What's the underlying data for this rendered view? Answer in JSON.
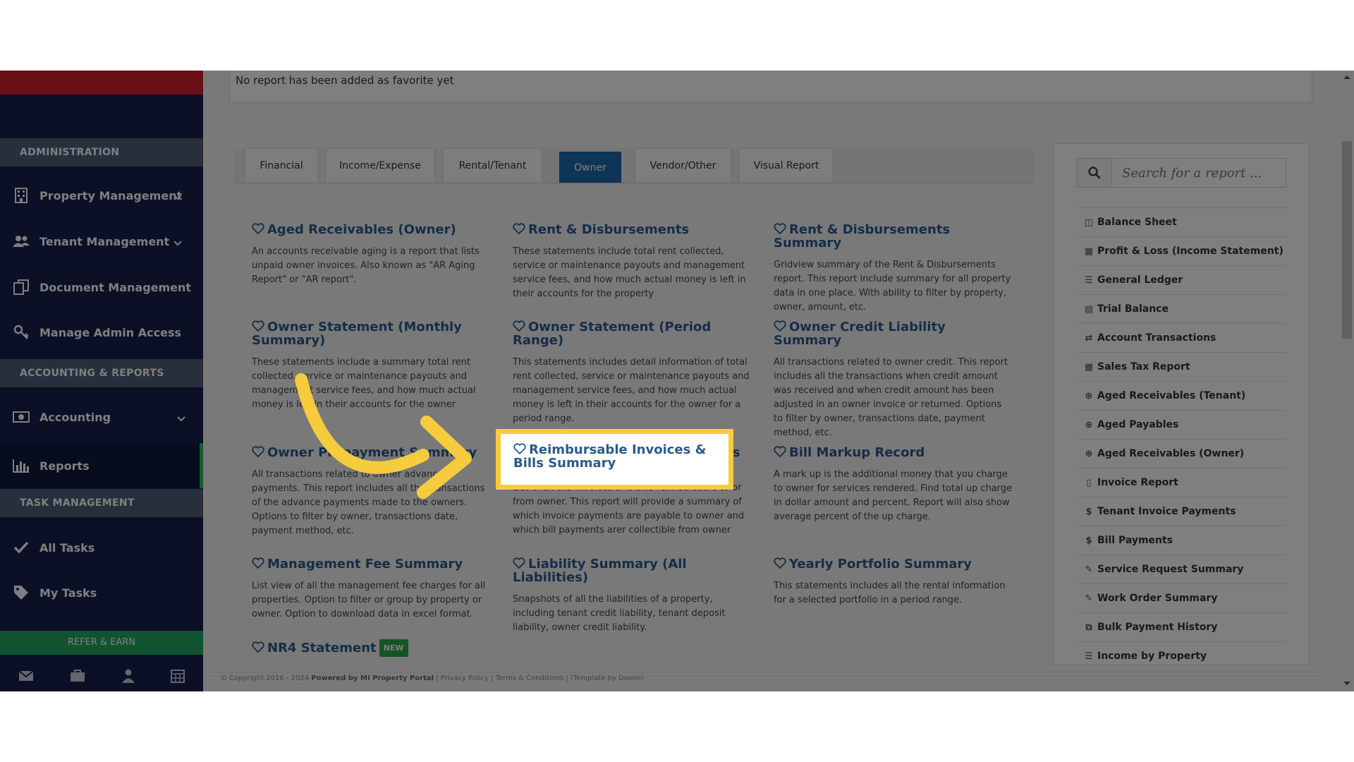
{
  "sidebar": {
    "sections": {
      "administration": "ADMINISTRATION",
      "accounting_reports": "ACCOUNTING & REPORTS",
      "task_management": "TASK MANAGEMENT"
    },
    "items": {
      "property_management": "Property Management",
      "tenant_management": "Tenant Management",
      "document_management": "Document Management",
      "manage_admin_access": "Manage Admin Access",
      "accounting": "Accounting",
      "reports": "Reports",
      "all_tasks": "All Tasks",
      "my_tasks": "My Tasks"
    },
    "refer_earn": "REFER & EARN"
  },
  "favorites": {
    "empty_text": "No report has been added as favorite yet"
  },
  "tabs": {
    "financial": "Financial",
    "income_expense": "Income/Expense",
    "rental_tenant": "Rental/Tenant",
    "owner": "Owner",
    "vendor_other": "Vendor/Other",
    "visual_report": "Visual Report",
    "active": "Owner"
  },
  "reports": {
    "aged_receivables_owner": {
      "title": "Aged Receivables (Owner)",
      "desc": "An accounts receivable aging is a report that lists unpaid owner invoices. Also known as \"AR Aging Report\" or \"AR report\"."
    },
    "rent_disbursements": {
      "title": "Rent & Disbursements",
      "desc": "These statements include total rent collected, service or maintenance payouts and management service fees, and how much actual money is left in their accounts for the property"
    },
    "rent_disbursements_summary": {
      "title": "Rent & Disbursements Summary",
      "desc": "Gridview summary of the Rent & Disbursements report. This report include summary for all property data in one place. With ability to filter by property, owner, amount, etc."
    },
    "owner_statement_monthly": {
      "title": "Owner Statement (Monthly Summary)",
      "desc": "These statements include a summary total rent collected, service or maintenance payouts and management service fees, and how much actual money is left in their accounts for the owner"
    },
    "owner_statement_period": {
      "title": "Owner Statement (Period Range)",
      "desc": "This statements includes detail information of total rent collected, service or maintenance payouts and management service fees, and how much actual money is left in their accounts for the owner for a period range."
    },
    "owner_credit_liability": {
      "title": "Owner Credit Liability Summary",
      "desc": "All transactions related to owner credit. This report includes all the transactions when credit amount was received and when credit amount has been adjusted in an owner invoice or returned. Options to filter by owner, transactions date, payment method, etc."
    },
    "owner_prepayment": {
      "title": "Owner Prepayment Summary",
      "desc": "All transactions related to owner advance payments. This report includes all the transactions of the advance payments made to the owners. Options to filter by owner, transactions date, payment method, etc."
    },
    "reimbursable": {
      "title": "Reimbursable Invoices & Bills Summary",
      "desc": "List of all the invoices and bills reimbursable to or from owner. This report will provide a summary of which invoice payments are payable to owner and which bill payments arer collectible from owner"
    },
    "bill_markup": {
      "title": "Bill Markup Record",
      "desc": "A mark up is the additional money that you charge to owner for services rendered. Find total up charge in dollar amount and percent. Report will also show average percent of the up charge."
    },
    "management_fee": {
      "title": "Management Fee Summary",
      "desc": "List view of all the management fee charges for all properties. Option to filter or group by property or owner. Option to download data in excel format."
    },
    "liability_summary": {
      "title": "Liability Summary (All Liabilities)",
      "desc": "Snapshots of all the liabilities of a property, including tenant credit liability, tenant deposit liability, owner credit liability."
    },
    "yearly_portfolio": {
      "title": "Yearly Portfolio Summary",
      "desc": "This statements includes all the rental information for a selected portfolio in a period range."
    },
    "nr4_statement": {
      "title": "NR4 Statement",
      "badge": "NEW"
    }
  },
  "search": {
    "placeholder": "Search for a report ..."
  },
  "quick_links": [
    {
      "label": "Balance Sheet",
      "icon": "columns-icon"
    },
    {
      "label": "Profit & Loss (Income Statement)",
      "icon": "calculator-icon"
    },
    {
      "label": "General Ledger",
      "icon": "list-icon"
    },
    {
      "label": "Trial Balance",
      "icon": "calendar-icon"
    },
    {
      "label": "Account Transactions",
      "icon": "exchange-icon"
    },
    {
      "label": "Sales Tax Report",
      "icon": "calculator-icon"
    },
    {
      "label": "Aged Receivables (Tenant)",
      "icon": "circle-plus-icon"
    },
    {
      "label": "Aged Payables",
      "icon": "circle-plus-icon"
    },
    {
      "label": "Aged Receivables (Owner)",
      "icon": "circle-plus-icon"
    },
    {
      "label": "Invoice Report",
      "icon": "file-icon"
    },
    {
      "label": "Tenant Invoice Payments",
      "icon": "dollar-icon"
    },
    {
      "label": "Bill Payments",
      "icon": "dollar-icon"
    },
    {
      "label": "Service Request Summary",
      "icon": "wrench-icon"
    },
    {
      "label": "Work Order Summary",
      "icon": "wrench-icon"
    },
    {
      "label": "Bulk Payment History",
      "icon": "copy-icon"
    },
    {
      "label": "Income by Property",
      "icon": "list-icon"
    }
  ],
  "footer": {
    "copyright": "© Copyright 2016 - 2024",
    "powered": "Powered by MI Property Portal",
    "privacy": "Privacy Policy",
    "terms": "Terms & Conditions",
    "template": "(Template by Doxmi)"
  },
  "colors": {
    "sidebar_bg": "#16214f",
    "brand_red": "#d3202d",
    "accent_blue": "#1e6aad",
    "highlight_yellow": "#f6cb3e",
    "link_blue": "#2a5a8f",
    "new_green": "#2aa84a"
  }
}
